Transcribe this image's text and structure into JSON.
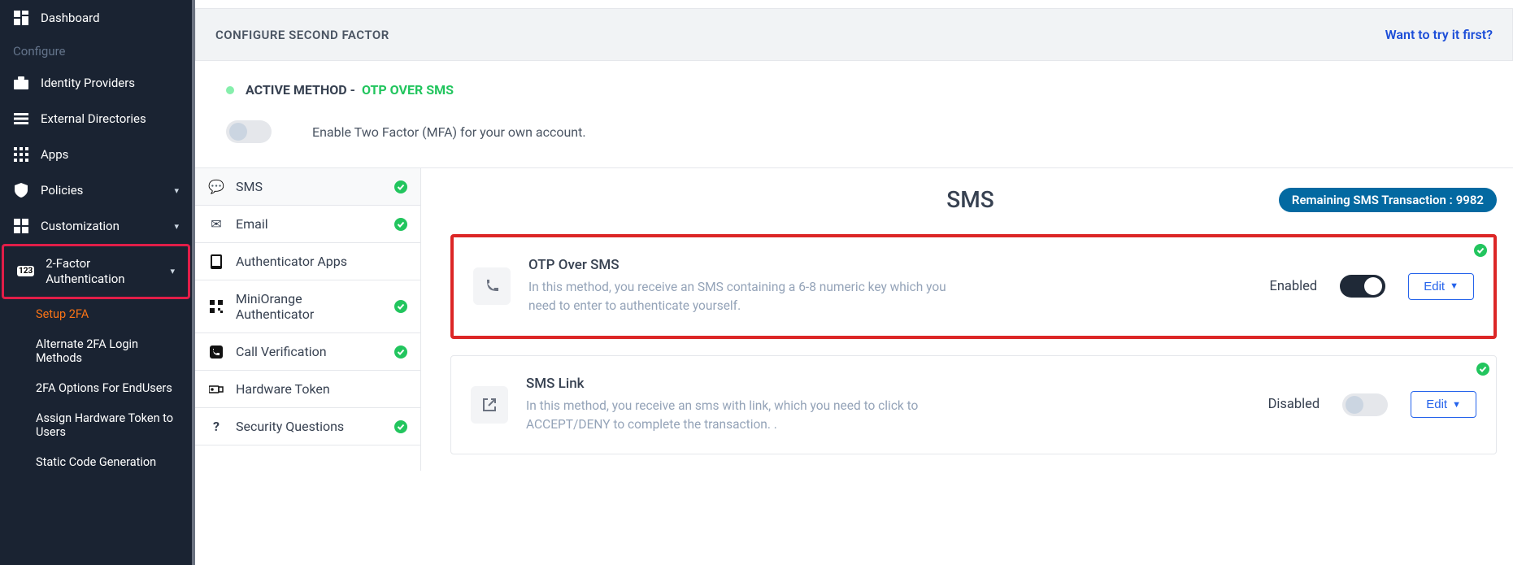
{
  "sidebar": {
    "dashboard": "Dashboard",
    "section_configure": "Configure",
    "identity_providers": "Identity Providers",
    "external_directories": "External Directories",
    "apps": "Apps",
    "policies": "Policies",
    "customization": "Customization",
    "twofa": "2-Factor Authentication",
    "twofa_badge": "123",
    "sub": {
      "setup": "Setup 2FA",
      "alternate": "Alternate 2FA Login Methods",
      "endusers": "2FA Options For EndUsers",
      "assign_token": "Assign Hardware Token to Users",
      "static_code": "Static Code Generation"
    }
  },
  "header": {
    "title": "CONFIGURE SECOND FACTOR",
    "try_link": "Want to try it first?"
  },
  "active_method": {
    "label": "ACTIVE METHOD - ",
    "value": "OTP OVER SMS"
  },
  "enable_toggle_text": "Enable Two Factor (MFA) for your own account.",
  "tabs": {
    "sms": "SMS",
    "email": "Email",
    "auth_apps": "Authenticator Apps",
    "mo_auth": "MiniOrange Authenticator",
    "call": "Call Verification",
    "hw_token": "Hardware Token",
    "sec_q": "Security Questions"
  },
  "panel": {
    "title": "SMS",
    "badge_label": "Remaining SMS Transaction : ",
    "badge_value": "9982"
  },
  "cards": [
    {
      "title": "OTP Over SMS",
      "desc": "In this method, you receive an SMS containing a 6-8 numeric key which you need to enter to authenticate yourself.",
      "status": "Enabled",
      "toggle_on": true,
      "edit": "Edit"
    },
    {
      "title": "SMS Link",
      "desc": "In this method, you receive an sms with link, which you need to click to ACCEPT/DENY to complete the transaction. .",
      "status": "Disabled",
      "toggle_on": false,
      "edit": "Edit"
    }
  ]
}
